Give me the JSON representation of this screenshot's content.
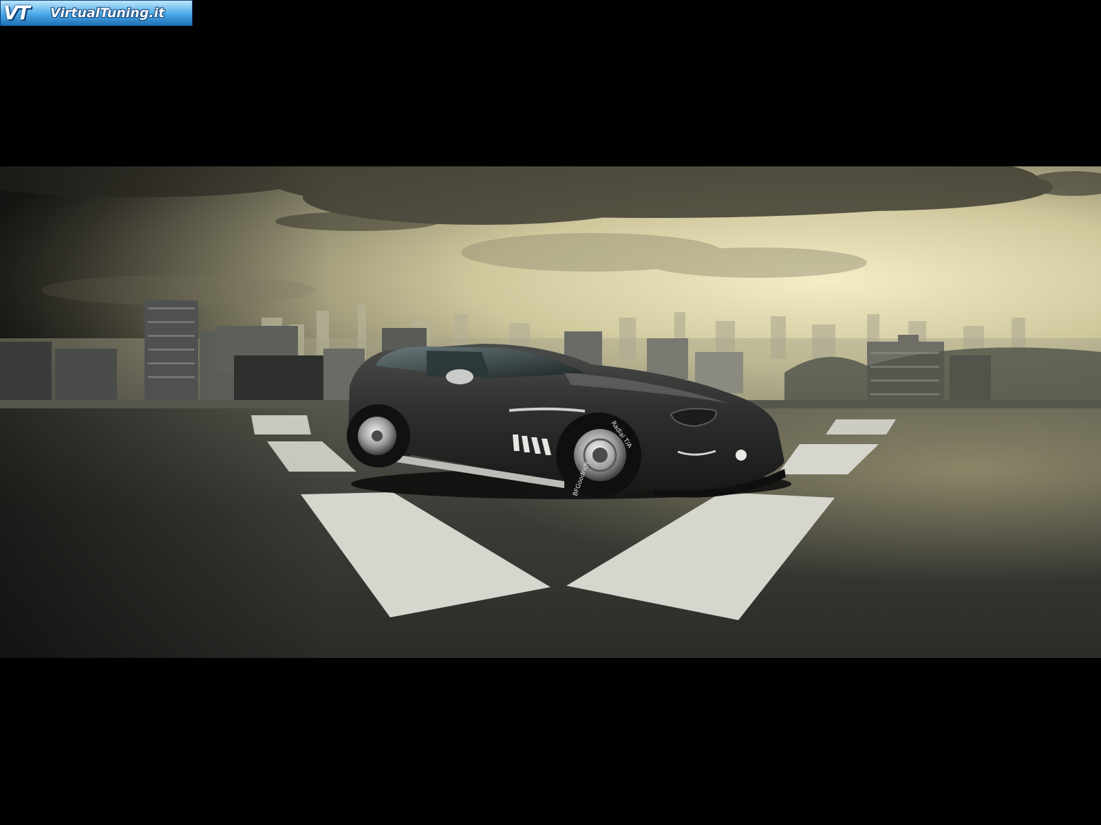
{
  "logo": {
    "mark": "VT",
    "text": "VirtualTuning.it"
  },
  "scene": {
    "subject": "dark-grey-concept-shooting-brake-car",
    "setting": "rooftop-helipad-city-skyline",
    "tire_brand_text": "BFGoodrich",
    "tire_model_text": "Radial T/A",
    "colors": {
      "sky_glow": "#efe6b8",
      "cloud": "#3c3a2f",
      "deck": "#3a3c36",
      "marking": "#d9d9d2",
      "car_body": "#2c2d2c"
    }
  }
}
